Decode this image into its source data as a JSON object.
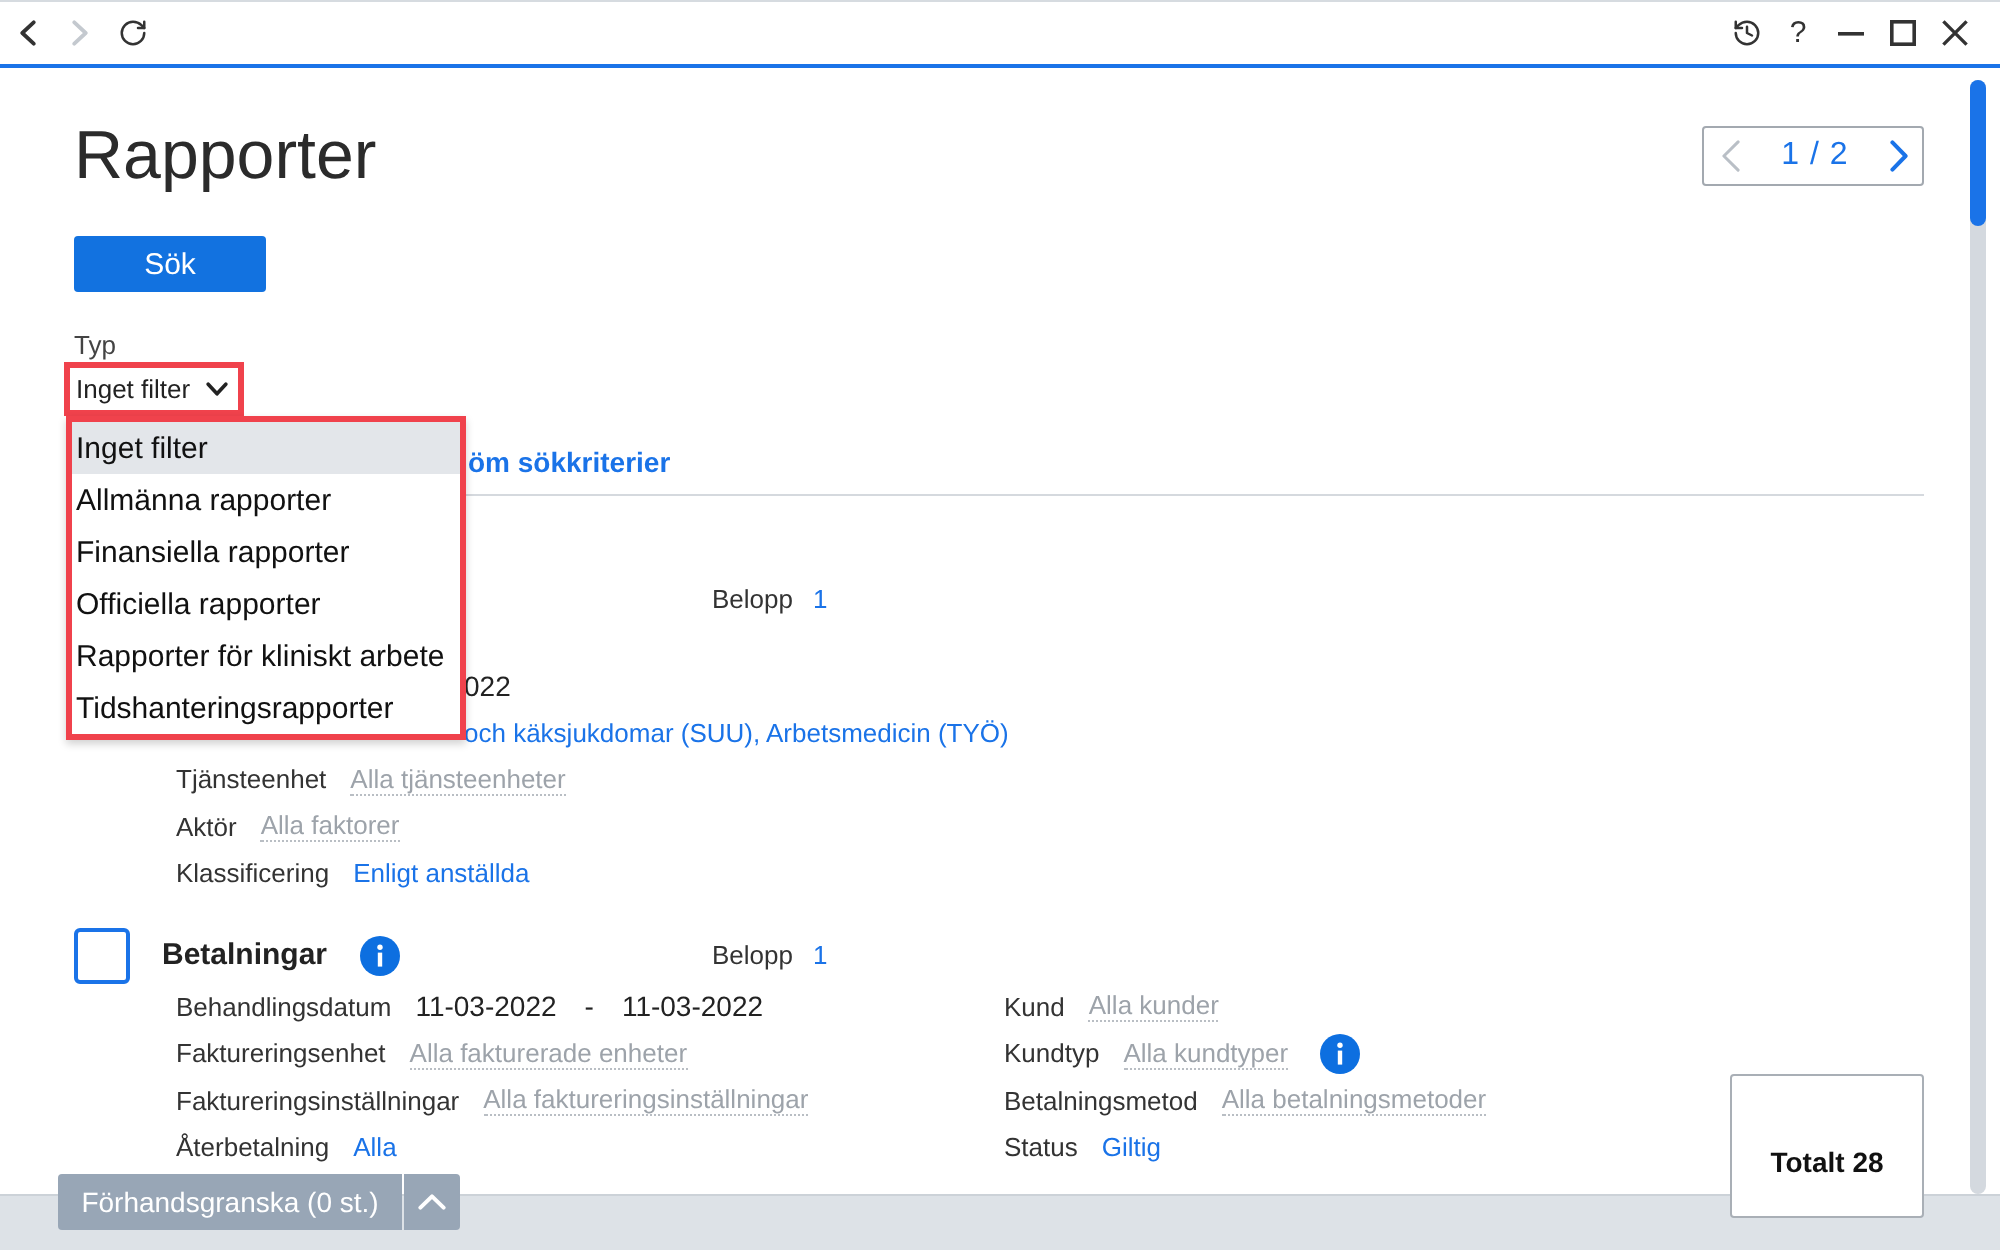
{
  "nav_buttons": [
    {
      "kind": "back",
      "disabled": false
    },
    {
      "kind": "forward",
      "disabled": true
    },
    {
      "kind": "refresh",
      "disabled": false
    }
  ],
  "window_controls": [
    {
      "kind": "history"
    },
    {
      "kind": "help",
      "label": "?"
    },
    {
      "kind": "minimize"
    },
    {
      "kind": "maximize"
    },
    {
      "kind": "close"
    }
  ],
  "page": {
    "title": "Rapporter",
    "pager": {
      "text": "1 / 2",
      "prev_disabled": true,
      "next_disabled": false
    },
    "search_button": "Sök",
    "type_filter": {
      "label": "Typ",
      "value": "Inget filter",
      "expanded": true,
      "options": [
        {
          "label": "Inget filter",
          "selected": true
        },
        {
          "label": "Allmänna rapporter",
          "selected": false
        },
        {
          "label": "Finansiella rapporter",
          "selected": false
        },
        {
          "label": "Officiella rapporter",
          "selected": false
        },
        {
          "label": "Rapporter för kliniskt arbete",
          "selected": false
        },
        {
          "label": "Tidshanteringsrapporter",
          "selected": false
        }
      ]
    },
    "clear_link": "öm sökkriterier",
    "sections": [
      {
        "amount_label": "Belopp",
        "amount": "1",
        "columns": [
          [
            {
              "kind": "text",
              "value": "022"
            },
            {
              "kind": "link",
              "value": "och käksjukdomar (SUU), Arbetsmedicin (TYÖ)"
            },
            {
              "label": "Tjänsteenhet",
              "kind": "default",
              "value": "Alla tjänsteenheter"
            },
            {
              "label": "Aktör",
              "kind": "default",
              "value": "Alla faktorer"
            },
            {
              "label": "Klassificering",
              "kind": "link",
              "value": "Enligt anställda"
            }
          ]
        ]
      },
      {
        "title": "Betalningar",
        "checked": false,
        "info": true,
        "amount_label": "Belopp",
        "amount": "1",
        "columns": [
          [
            {
              "label": "Behandlingsdatum",
              "kind": "range",
              "from": "11-03-2022",
              "separator": "-",
              "to": "11-03-2022"
            },
            {
              "label": "Faktureringsenhet",
              "kind": "default",
              "value": "Alla fakturerade enheter"
            },
            {
              "label": "Faktureringsinställningar",
              "kind": "default",
              "value": "Alla faktureringsinställningar"
            },
            {
              "label": "Återbetalning",
              "kind": "link",
              "value": "Alla"
            }
          ],
          [
            {
              "label": "Kund",
              "kind": "default",
              "value": "Alla kunder"
            },
            {
              "label": "Kundtyp",
              "kind": "default",
              "value": "Alla kundtyper",
              "info": true
            },
            {
              "label": "Betalningsmetod",
              "kind": "default",
              "value": "Alla betalningsmetoder"
            },
            {
              "label": "Status",
              "kind": "link",
              "value": "Giltig"
            }
          ]
        ]
      }
    ]
  },
  "footer": {
    "preview_button": {
      "label": "Förhandsgranska (0 st.)",
      "disabled": true
    },
    "total": "Totalt 28"
  }
}
